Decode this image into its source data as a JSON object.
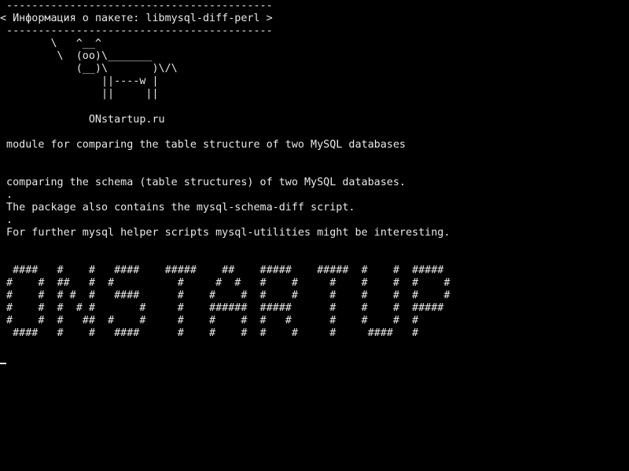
{
  "terminal": {
    "text_color": "#e8e8e8",
    "background_color": "#000000",
    "cowsay": {
      "border_top": " ------------------------------------------",
      "message": "< Информация о пакете: libmysql-diff-perl >",
      "border_bottom": " ------------------------------------------",
      "cow_line_1": "        \\   ^__^",
      "cow_line_2": "         \\  (oo)\\_______",
      "cow_line_3": "            (__)\\       )\\/\\",
      "cow_line_4": "                ||----w |",
      "cow_line_5": "                ||     ||"
    },
    "site": "              ONstartup.ru",
    "summary": " module for comparing the table structure of two MySQL databases",
    "description": [
      " comparing the schema (table structures) of two MySQL databases.",
      " .",
      " The package also contains the mysql-schema-diff script.",
      " .",
      " For further mysql helper scripts mysql-utilities might be interesting."
    ],
    "banner": [
      "  ####   #    #   ####    #####    ##    #####    #####  #    #  #####",
      " #    #  ##   #  #          #     #  #   #    #     #    #    #  #    #",
      " #    #  # #  #   ####      #    #    #  #    #     #    #    #  #    #",
      " #    #  #  # #       #     #    ######  #####      #    #    #  #####",
      " #    #  #   ##  #    #     #    #    #  #   #      #    #    #  #",
      "  ####   #    #   ####      #    #    #  #    #     #     ####   #"
    ]
  }
}
